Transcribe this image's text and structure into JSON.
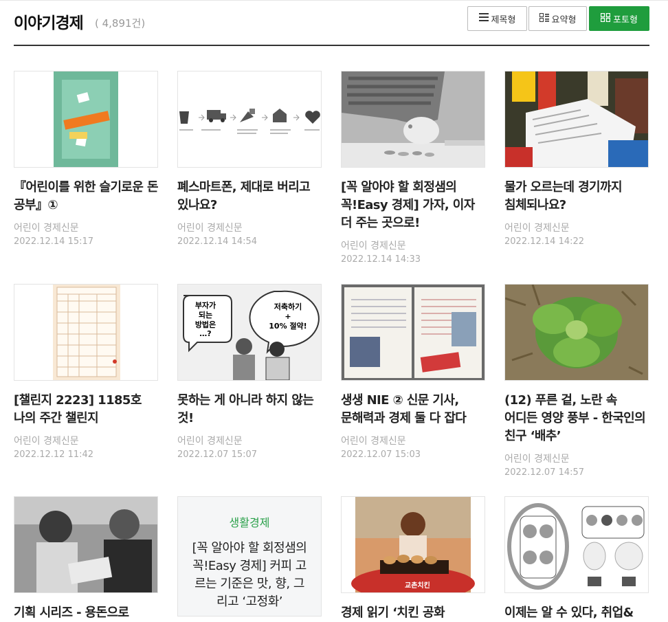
{
  "header": {
    "title": "이야기경제",
    "count": "( 4,891건)",
    "view_buttons": [
      {
        "label": "제목형",
        "icon": "list-icon",
        "active": false
      },
      {
        "label": "요약형",
        "icon": "summary-icon",
        "active": false
      },
      {
        "label": "포토형",
        "icon": "grid-icon",
        "active": true
      }
    ]
  },
  "colors": {
    "accent": "#1f9d3d",
    "text": "#222222",
    "meta": "#aaaaaa"
  },
  "articles": [
    {
      "title": "『어린이를 위한 슬기로운 돈 공부』①",
      "source": "어린이 경제신문",
      "date": "2022.12.14 15:17",
      "thumb": "board-game-image"
    },
    {
      "title": "폐스마트폰, 제대로 버리고 있나요?",
      "source": "어린이 경제신문",
      "date": "2022.12.14 14:54",
      "thumb": "recycle-process-image"
    },
    {
      "title": "[꼭 알아야 할 회정샘의 꼭!Easy 경제] 가자, 이자 더 주는 곳으로!",
      "source": "어린이 경제신문",
      "date": "2022.12.14 14:33",
      "thumb": "piggy-bank-image"
    },
    {
      "title": "물가 오르는데 경기까지 침체되나요?",
      "source": "어린이 경제신문",
      "date": "2022.12.14 14:22",
      "thumb": "receipt-groceries-image"
    },
    {
      "title": "[챌린지 2223] 1185호 나의 주간 챌린지",
      "source": "어린이 경제신문",
      "date": "2022.12.12 11:42",
      "thumb": "worksheet-image"
    },
    {
      "title": "못하는 게 아니라 하지 않는 것!",
      "source": "어린이 경제신문",
      "date": "2022.12.07 15:07",
      "thumb": "cartoon-image",
      "bubbles": [
        "부자가",
        "되는",
        "방법은",
        "…?",
        "저축하기",
        "+",
        "10% 절약!"
      ]
    },
    {
      "title": "생생 NIE ② 신문 기사, 문해력과 경제 둘 다 잡다",
      "source": "어린이 경제신문",
      "date": "2022.12.07 15:03",
      "thumb": "notebook-image"
    },
    {
      "title": "(12) 푸른 겉, 노란 속 어디든 영양 풍부 - 한국인의 친구 ‘배추’",
      "source": "어린이 경제신문",
      "date": "2022.12.07 14:57",
      "thumb": "cabbage-image"
    },
    {
      "title": "기획 시리즈 - 용돈으로",
      "source": "",
      "date": "",
      "thumb": "kids-building-image"
    },
    {
      "title": "",
      "source": "",
      "date": "",
      "thumb": "text-thumb",
      "text_category": "생활경제",
      "text_body": "[꼭 알아야 할 회정샘의 꼭!Easy 경제] 커피 고르는 기준은 맛, 향, 그리고 ‘고정화’"
    },
    {
      "title": "경제 읽기 ‘치킨 공화",
      "source": "",
      "date": "",
      "thumb": "chicken-ad-image",
      "logo_text": "교촌치킨"
    },
    {
      "title": "이제는 알 수 있다, 취업&",
      "source": "",
      "date": "",
      "thumb": "diagram-image"
    }
  ]
}
